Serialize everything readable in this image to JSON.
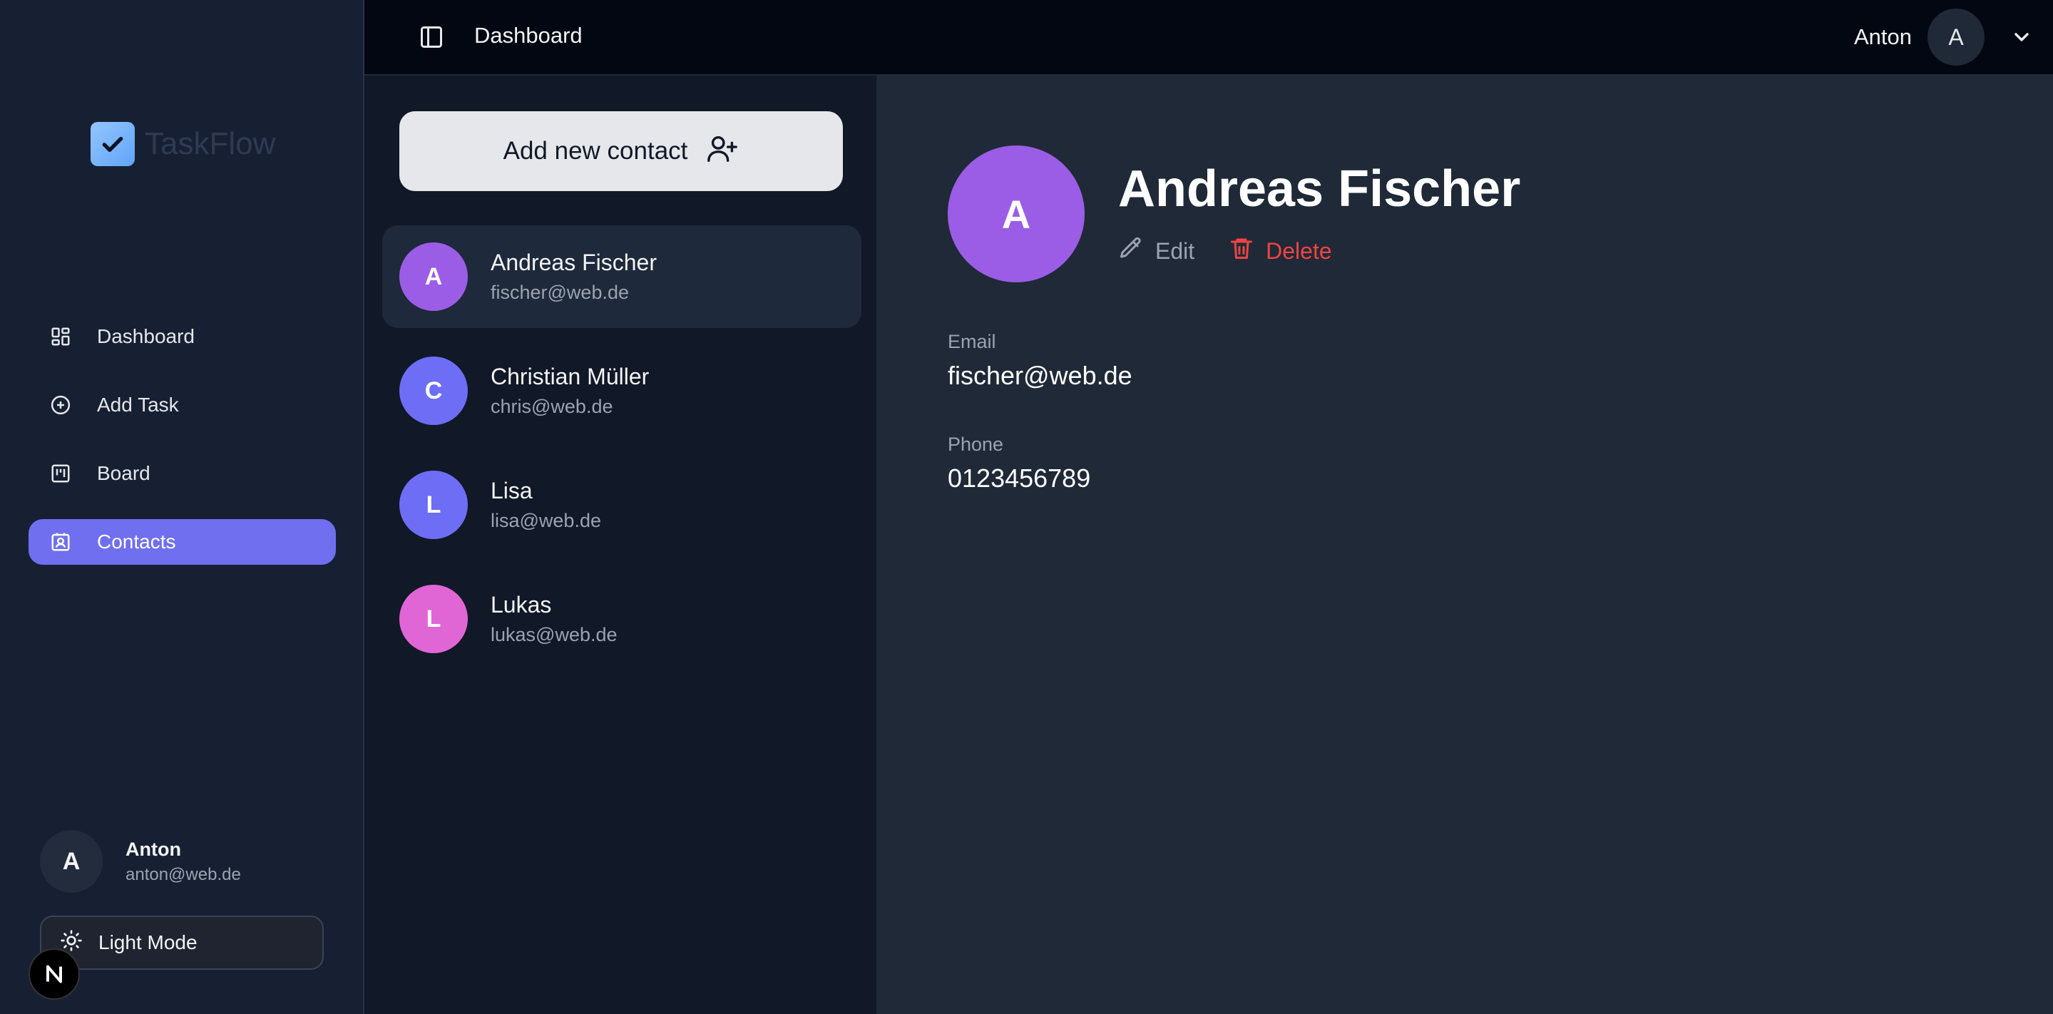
{
  "sidebar": {
    "logo_text": "TaskFlow",
    "nav": [
      {
        "label": "Dashboard",
        "icon": "dashboard-icon",
        "active": false
      },
      {
        "label": "Add Task",
        "icon": "plus-circle-icon",
        "active": false
      },
      {
        "label": "Board",
        "icon": "kanban-icon",
        "active": false
      },
      {
        "label": "Contacts",
        "icon": "contact-card-icon",
        "active": true
      }
    ],
    "user": {
      "initial": "A",
      "name": "Anton",
      "email": "anton@web.de"
    },
    "theme_toggle_label": "Light Mode",
    "badge_letter": "N"
  },
  "topbar": {
    "title": "Dashboard",
    "user_name": "Anton",
    "user_initial": "A"
  },
  "contacts": {
    "add_button_label": "Add new contact",
    "items": [
      {
        "initial": "A",
        "name": "Andreas Fischer",
        "email": "fischer@web.de",
        "color": "#9b5de5",
        "selected": true
      },
      {
        "initial": "C",
        "name": "Christian Müller",
        "email": "chris@web.de",
        "color": "#6d6ef5",
        "selected": false
      },
      {
        "initial": "L",
        "name": "Lisa",
        "email": "lisa@web.de",
        "color": "#6d6ef5",
        "selected": false
      },
      {
        "initial": "L",
        "name": "Lukas",
        "email": "lukas@web.de",
        "color": "#e066d6",
        "selected": false
      }
    ]
  },
  "detail": {
    "initial": "A",
    "name": "Andreas Fischer",
    "edit_label": "Edit",
    "delete_label": "Delete",
    "email_label": "Email",
    "email_value": "fischer@web.de",
    "phone_label": "Phone",
    "phone_value": "0123456789"
  },
  "colors": {
    "accent": "#6f6ff0",
    "danger": "#ef4444",
    "detail_avatar": "#9b5de5"
  }
}
